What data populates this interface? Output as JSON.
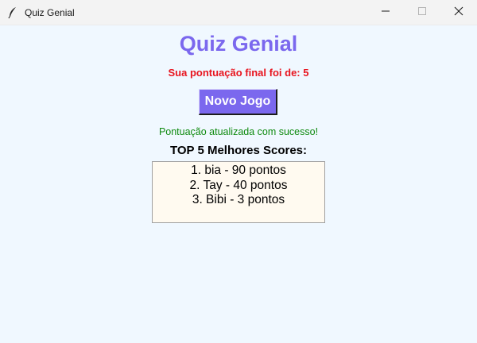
{
  "window": {
    "title": "Quiz Genial",
    "controls": [
      "minimize-icon",
      "maximize-icon",
      "close-icon"
    ]
  },
  "main": {
    "title": "Quiz Genial",
    "final_score_text": "Sua pontuação final foi de: 5",
    "new_game_label": "Novo Jogo",
    "status_message": "Pontuação atualizada com sucesso!",
    "top_heading": "TOP 5 Melhores Scores:",
    "scores": [
      "1. bia - 90 pontos",
      "2. Tay - 40 pontos",
      "3. Bibi - 3 pontos"
    ]
  },
  "colors": {
    "background": "#f0f8ff",
    "accent": "#7b68ee",
    "score_red": "#e8141e",
    "success_green": "#0f8a0f",
    "list_bg": "#fffaf0"
  }
}
